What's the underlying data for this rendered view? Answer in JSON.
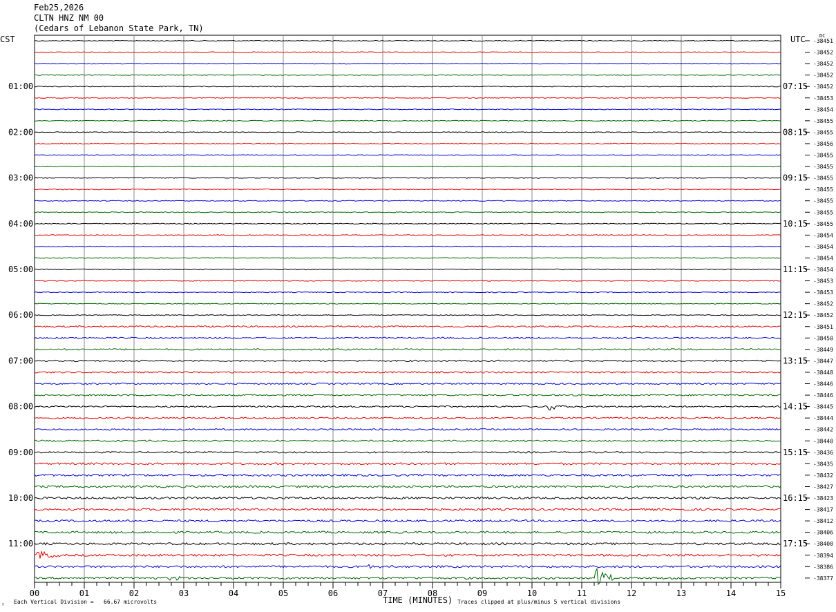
{
  "header": {
    "date": "Feb25,2026",
    "station": "CLTN HNZ NM 00",
    "location": "(Cedars of Lebanon State Park, TN)"
  },
  "left_zone": "CST",
  "right_zone": "UTC",
  "dc_label": "DC",
  "footer": {
    "division": "Each Vertical Division =   66.67 microvolts",
    "clip": "Traces clipped at plus/minus 5 vertical divisions",
    "logo": "↑"
  },
  "chart_data": {
    "type": "line",
    "xlabel": "TIME (MINUTES)",
    "xlim": [
      0,
      15
    ],
    "x_ticks": [
      "00",
      "01",
      "02",
      "03",
      "04",
      "05",
      "06",
      "07",
      "08",
      "09",
      "10",
      "11",
      "12",
      "13",
      "14",
      "15"
    ],
    "trace_colors": [
      "#000000",
      "#e00000",
      "#0000d0",
      "#006400"
    ],
    "left_hour_labels": [
      "01:00",
      "02:00",
      "03:00",
      "04:00",
      "05:00",
      "06:00",
      "07:00",
      "08:00",
      "09:00",
      "10:00",
      "11:00"
    ],
    "right_hour_labels": [
      "07:15",
      "08:15",
      "09:15",
      "10:15",
      "11:15",
      "12:15",
      "13:15",
      "14:15",
      "15:15",
      "16:15",
      "17:15"
    ],
    "trace_dc_values": [
      "-38451",
      "-38452",
      "-38452",
      "-38452",
      "-38452",
      "-38453",
      "-38454",
      "-38455",
      "-38455",
      "-38456",
      "-38455",
      "-38455",
      "-38455",
      "-38455",
      "-38455",
      "-38455",
      "-38455",
      "-38454",
      "-38454",
      "-38454",
      "-38454",
      "-38453",
      "-38453",
      "-38452",
      "-38452",
      "-38451",
      "-38450",
      "-38449",
      "-38447",
      "-38448",
      "-38446",
      "-38446",
      "-38445",
      "-38444",
      "-38442",
      "-38440",
      "-38436",
      "-38435",
      "-38432",
      "-38427",
      "-38423",
      "-38417",
      "-38412",
      "-38406",
      "-38400",
      "-38394",
      "-38386",
      "-38377"
    ],
    "events": [
      {
        "trace": 32,
        "minute": 10.35,
        "amplitude": 7
      },
      {
        "trace": 45,
        "minute": 0.08,
        "amplitude": 9
      },
      {
        "trace": 47,
        "minute": 11.3,
        "amplitude": 15
      },
      {
        "trace": 46,
        "minute": 6.75,
        "amplitude": 3
      },
      {
        "trace": 47,
        "minute": 2.75,
        "amplitude": 3
      }
    ]
  }
}
